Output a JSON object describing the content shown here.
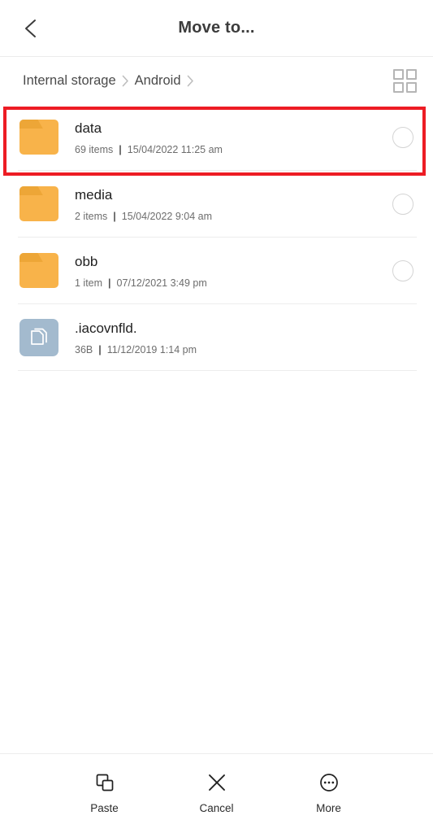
{
  "header": {
    "title": "Move to...",
    "back_icon": "chevron-left-icon"
  },
  "breadcrumb": {
    "separator": "›",
    "items": [
      {
        "label": "Internal storage"
      },
      {
        "label": "Android"
      }
    ],
    "view_toggle_icon": "grid-view-icon"
  },
  "file_list": {
    "items": [
      {
        "name": "data",
        "type": "folder",
        "icon": "folder-icon",
        "count": "69 items",
        "separator": "|",
        "date": "15/04/2022 11:25 am",
        "has_radio": true,
        "selected": false,
        "highlighted": true
      },
      {
        "name": "media",
        "type": "folder",
        "icon": "folder-icon",
        "count": "2 items",
        "separator": "|",
        "date": "15/04/2022 9:04 am",
        "has_radio": true,
        "selected": false,
        "highlighted": false
      },
      {
        "name": "obb",
        "type": "folder",
        "icon": "folder-icon",
        "count": "1 item",
        "separator": "|",
        "date": "07/12/2021 3:49 pm",
        "has_radio": true,
        "selected": false,
        "highlighted": false
      },
      {
        "name": ".iacovnfld.",
        "type": "file",
        "icon": "document-file-icon",
        "count": "36B",
        "separator": "|",
        "date": "11/12/2019 1:14 pm",
        "has_radio": false,
        "selected": false,
        "highlighted": false
      }
    ]
  },
  "bottom_bar": {
    "actions": [
      {
        "label": "Paste",
        "icon": "paste-icon"
      },
      {
        "label": "Cancel",
        "icon": "close-x-icon"
      },
      {
        "label": "More",
        "icon": "more-ellipsis-icon"
      }
    ]
  },
  "colors": {
    "folder": "#f8b34a",
    "folder_tab": "#eda637",
    "file_icon_bg": "#a3bace",
    "highlight": "#ed1c24",
    "divider": "#ededed",
    "text_primary": "#1f1f1f",
    "text_secondary": "#6d6d6d"
  }
}
